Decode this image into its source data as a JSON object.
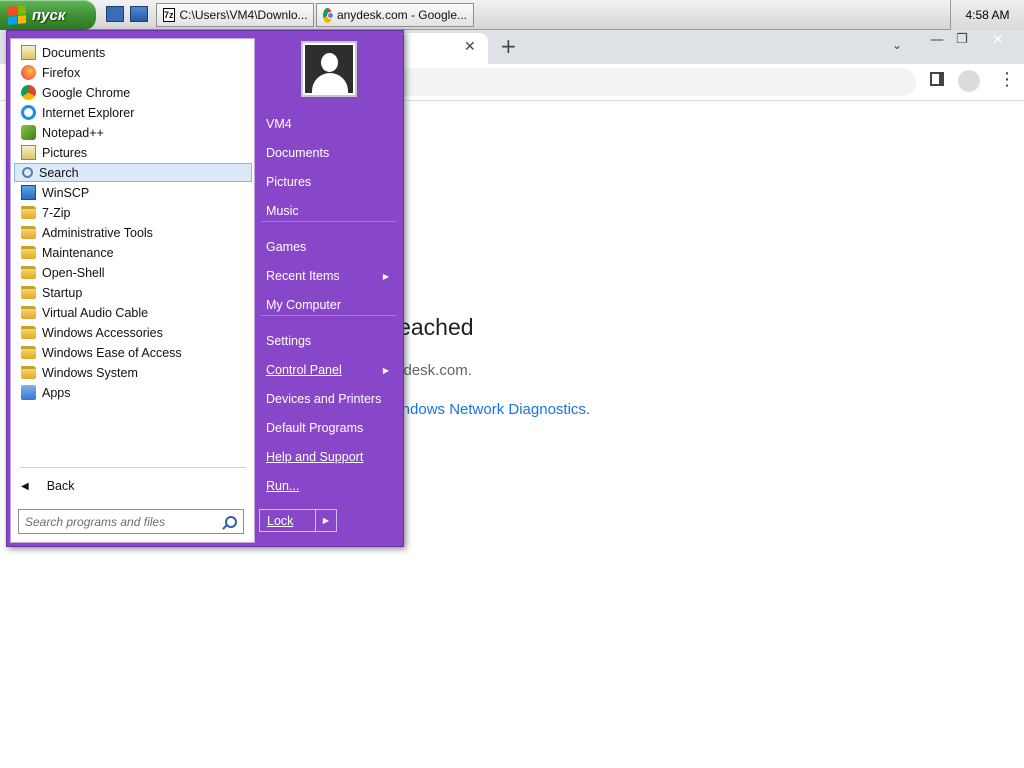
{
  "taskbar": {
    "start_label": "пуск",
    "tasks": [
      {
        "label": "C:\\Users\\VM4\\Downlo...",
        "icon": "7zip-icon"
      },
      {
        "label": "anydesk.com - Google...",
        "icon": "chrome-icon"
      }
    ],
    "clock": "4:58 AM"
  },
  "browser": {
    "error_title": "site can't be reached",
    "error_subtitle": "ydesk.com.",
    "diagnostics_link": "ing Windows Network Diagnostics."
  },
  "start_menu": {
    "programs": [
      {
        "label": "Documents",
        "icon": "documents-icon"
      },
      {
        "label": "Firefox",
        "icon": "firefox-icon"
      },
      {
        "label": "Google Chrome",
        "icon": "chrome-icon"
      },
      {
        "label": "Internet Explorer",
        "icon": "ie-icon"
      },
      {
        "label": "Notepad++",
        "icon": "notepadpp-icon"
      },
      {
        "label": "Pictures",
        "icon": "pictures-icon"
      },
      {
        "label": "Search",
        "icon": "search-icon"
      },
      {
        "label": "WinSCP",
        "icon": "winscp-icon"
      },
      {
        "label": "7-Zip",
        "icon": "folder-icon"
      },
      {
        "label": "Administrative Tools",
        "icon": "folder-icon"
      },
      {
        "label": "Maintenance",
        "icon": "folder-icon"
      },
      {
        "label": "Open-Shell",
        "icon": "folder-icon"
      },
      {
        "label": "Startup",
        "icon": "folder-icon"
      },
      {
        "label": "Virtual Audio Cable",
        "icon": "folder-icon"
      },
      {
        "label": "Windows Accessories",
        "icon": "folder-icon"
      },
      {
        "label": "Windows Ease of Access",
        "icon": "folder-icon"
      },
      {
        "label": "Windows System",
        "icon": "folder-icon"
      },
      {
        "label": "Apps",
        "icon": "apps-icon"
      }
    ],
    "selected_program": "Search",
    "back_label": "Back",
    "search_placeholder": "Search programs and files",
    "right_items": [
      {
        "label": "VM4"
      },
      {
        "label": "Documents"
      },
      {
        "label": "Pictures"
      },
      {
        "label": "Music"
      },
      {
        "label": "Games"
      },
      {
        "label": "Recent Items",
        "submenu": true
      },
      {
        "label": "My Computer"
      },
      {
        "label": "Settings"
      },
      {
        "label": "Control Panel",
        "submenu": true
      },
      {
        "label": "Devices and Printers"
      },
      {
        "label": "Default Programs"
      },
      {
        "label": "Help and Support"
      },
      {
        "label": "Run..."
      }
    ],
    "lock_label": "Lock",
    "accent_color": "#8847c8"
  }
}
